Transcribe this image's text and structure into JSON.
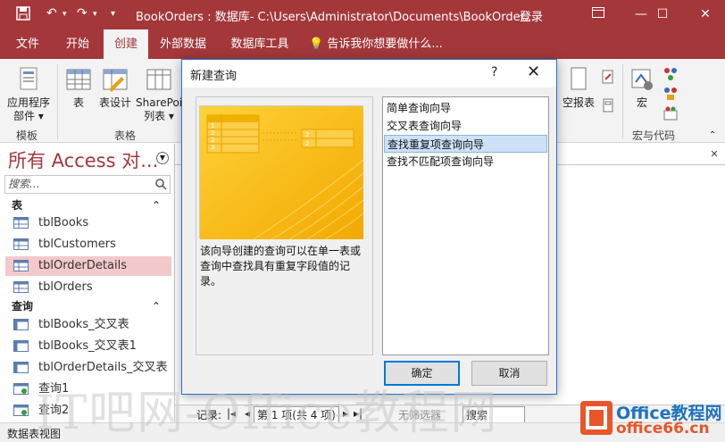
{
  "titlebar": {
    "title": "BookOrders : 数据库- C:\\Users\\Administrator\\Documents\\BookOrder...",
    "login": "登录",
    "save_icon": "save-icon",
    "undo_icon": "undo-icon",
    "redo_icon": "redo-icon",
    "customize_icon": "customize-icon",
    "help": "?",
    "minimize": "—",
    "maximize": "☐",
    "close": "✕"
  },
  "menu": {
    "tabs": [
      "文件",
      "开始",
      "创建",
      "外部数据",
      "数据库工具"
    ],
    "active": "创建",
    "tell_me": "告诉我你想要做什么..."
  },
  "ribbon": {
    "app_parts": "应用程序\n部件 ▾",
    "table": "表",
    "table_design": "表设计",
    "sharepoint": "SharePoi\n列表 ▾",
    "blank_report": "空报表",
    "macro": "宏",
    "group_templates": "模板",
    "group_tables": "表格",
    "group_macros": "宏与代码"
  },
  "nav": {
    "title": "所有 Access 对...",
    "search_placeholder": "搜索...",
    "section_tables": "表",
    "section_queries": "查询",
    "tables": [
      "tblBooks",
      "tblCustomers",
      "tblOrderDetails",
      "tblOrders"
    ],
    "selected_table": "tblOrderDetails",
    "queries": [
      "tblBooks_交叉表",
      "tblBooks_交叉表1",
      "tblOrderDetails_交叉表",
      "查询1",
      "查询2"
    ]
  },
  "dialog": {
    "title": "新建查询",
    "help": "?",
    "close": "✕",
    "description": "该向导创建的查询可以在单一表或查询中查找具有重复字段值的记录。",
    "wizards": [
      "简单查询向导",
      "交叉表查询向导",
      "查找重复项查询向导",
      "查找不匹配项查询向导"
    ],
    "selected_index": 2,
    "ok": "确定",
    "cancel": "取消"
  },
  "recbar": {
    "label": "记录:",
    "position": "第 1 项(共 4 项)",
    "filter": "无筛选器",
    "search": "搜索"
  },
  "status": {
    "text": "数据表视图"
  },
  "watermark": {
    "text": "IT吧网-Office教程网"
  },
  "logo": {
    "line1": "Office教程网",
    "line2": "office66.cn"
  },
  "colors": {
    "accent": "#a4373a",
    "selected_nav": "#f3c9cc",
    "dialog_border": "#1e76d2",
    "list_selection": "#cde1f7"
  }
}
